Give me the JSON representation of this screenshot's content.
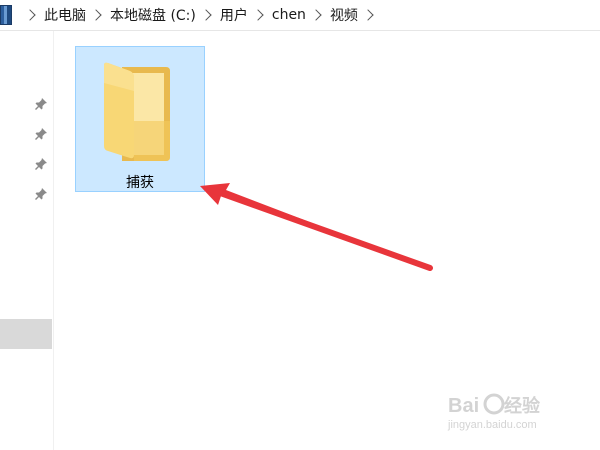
{
  "breadcrumb": {
    "items": [
      {
        "label": "此电脑"
      },
      {
        "label": "本地磁盘 (C:)"
      },
      {
        "label": "用户"
      },
      {
        "label": "chen"
      },
      {
        "label": "视频"
      }
    ]
  },
  "nav_pane": {
    "pins": [
      "pin-icon",
      "pin-icon",
      "pin-icon",
      "pin-icon"
    ]
  },
  "content": {
    "items": [
      {
        "name": "捕获",
        "type": "folder",
        "selected": true
      }
    ]
  },
  "annotation": {
    "arrow_color": "#e8353b"
  },
  "watermark": {
    "brand": "Baidu经验",
    "url": "jingyan.baidu.com"
  },
  "colors": {
    "selection_bg": "#cce8ff",
    "selection_border": "#99d1ff",
    "folder_yellow": "#f8d775"
  }
}
